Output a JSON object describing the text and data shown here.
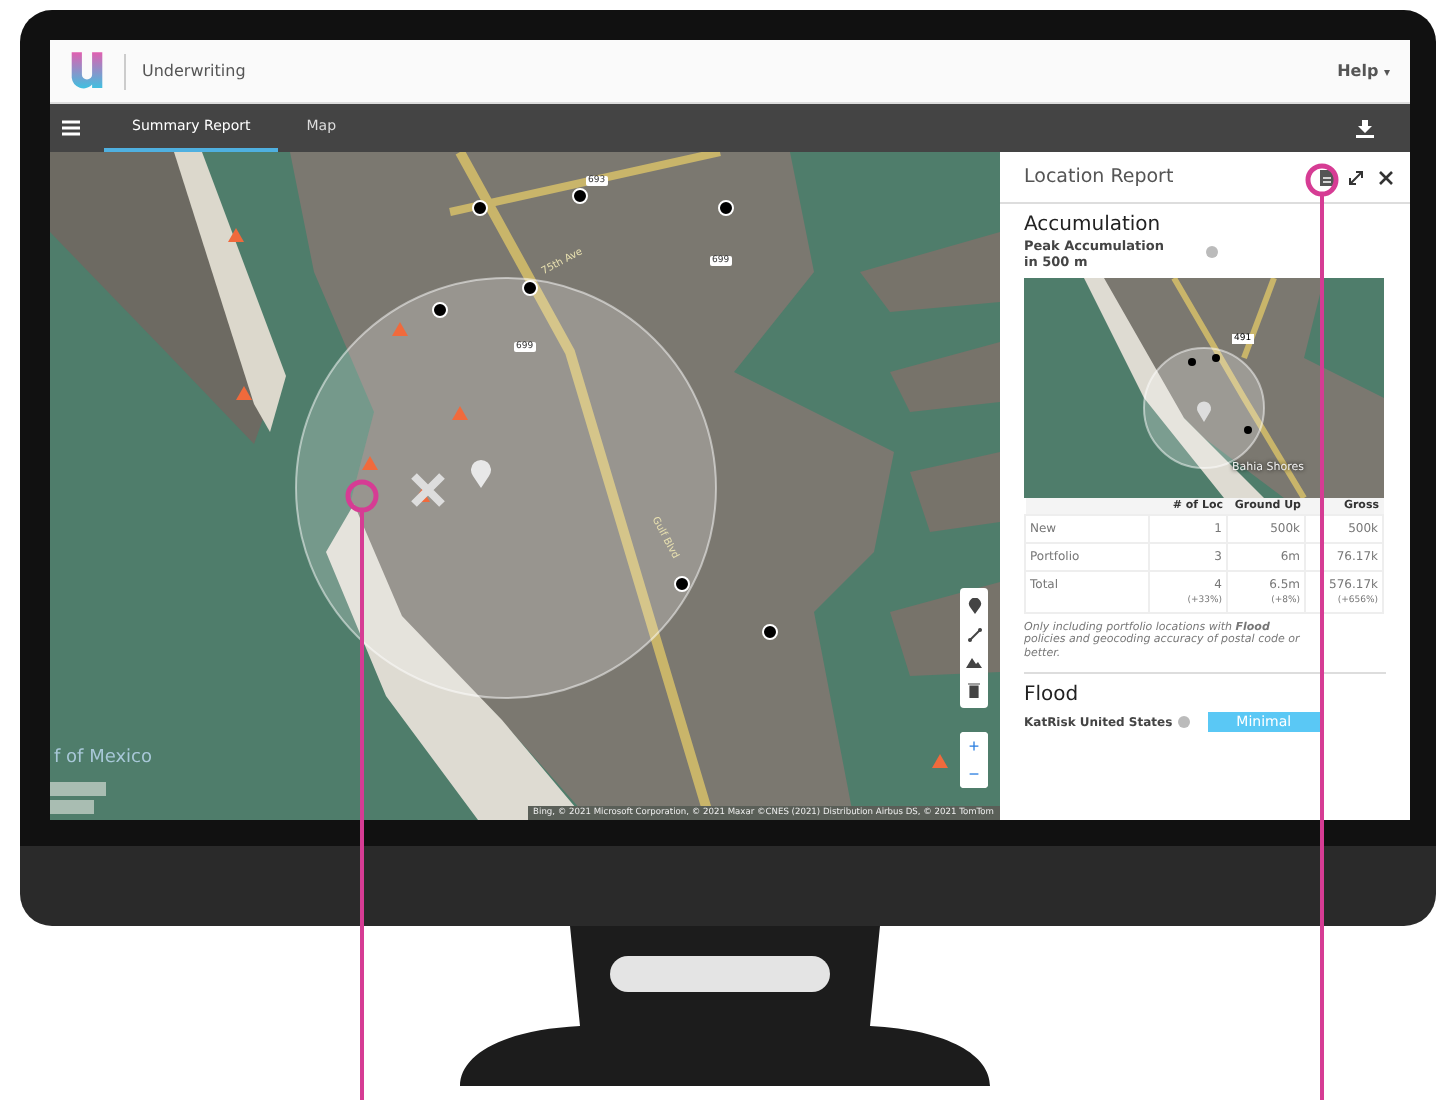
{
  "app": {
    "name": "Underwriting",
    "help": "Help",
    "help_caret": "▾"
  },
  "nav": {
    "tabs": [
      {
        "label": "Summary Report",
        "selected": true
      },
      {
        "label": "Map",
        "selected": false
      }
    ]
  },
  "map": {
    "region_label": "f of Mexico",
    "road_shields": [
      "693",
      "699",
      "699"
    ],
    "street_labels": [
      "75th Ave",
      "Gulf Blvd"
    ],
    "zoom_in": "+",
    "zoom_out": "−",
    "attribution": "Bing, © 2021 Microsoft Corporation, © 2021 Maxar ©CNES (2021) Distribution Airbus DS, © 2021 TomTom"
  },
  "panel": {
    "title": "Location Report",
    "section": "Accumulation",
    "metric": "Peak Accumulation in 500 m",
    "minimap": {
      "road_shield": "491",
      "place_label": "Bahia Shores"
    },
    "table": {
      "columns": [
        "# of Loc",
        "Ground Up",
        "Gross"
      ],
      "rows": [
        {
          "label": "New",
          "cells": [
            {
              "value": "1"
            },
            {
              "value": "500k"
            },
            {
              "value": "500k"
            }
          ]
        },
        {
          "label": "Portfolio",
          "cells": [
            {
              "value": "3"
            },
            {
              "value": "6m"
            },
            {
              "value": "76.17k"
            }
          ]
        },
        {
          "label": "Total",
          "cells": [
            {
              "value": "4",
              "change": "(+33%)"
            },
            {
              "value": "6.5m",
              "change": "(+8%)"
            },
            {
              "value": "576.17k",
              "change": "(+656%)"
            }
          ]
        }
      ]
    },
    "note": "Only including portfolio locations with **Flood** policies and geocoding accuracy of postal code or better.",
    "flood": {
      "title": "Flood",
      "model": "KatRisk United States",
      "risk_button": "Minimal"
    }
  }
}
